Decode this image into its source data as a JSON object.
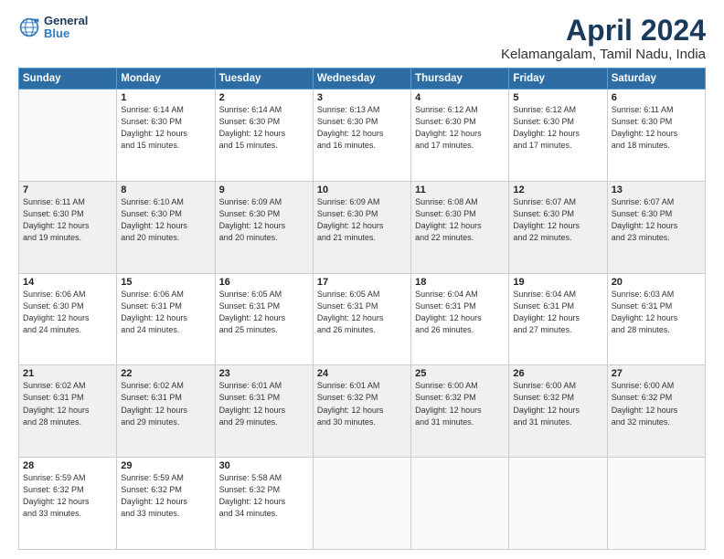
{
  "logo": {
    "line1": "General",
    "line2": "Blue"
  },
  "title": "April 2024",
  "subtitle": "Kelamangalam, Tamil Nadu, India",
  "days_of_week": [
    "Sunday",
    "Monday",
    "Tuesday",
    "Wednesday",
    "Thursday",
    "Friday",
    "Saturday"
  ],
  "weeks": [
    [
      {
        "date": "",
        "info": ""
      },
      {
        "date": "1",
        "info": "Sunrise: 6:14 AM\nSunset: 6:30 PM\nDaylight: 12 hours\nand 15 minutes."
      },
      {
        "date": "2",
        "info": "Sunrise: 6:14 AM\nSunset: 6:30 PM\nDaylight: 12 hours\nand 15 minutes."
      },
      {
        "date": "3",
        "info": "Sunrise: 6:13 AM\nSunset: 6:30 PM\nDaylight: 12 hours\nand 16 minutes."
      },
      {
        "date": "4",
        "info": "Sunrise: 6:12 AM\nSunset: 6:30 PM\nDaylight: 12 hours\nand 17 minutes."
      },
      {
        "date": "5",
        "info": "Sunrise: 6:12 AM\nSunset: 6:30 PM\nDaylight: 12 hours\nand 17 minutes."
      },
      {
        "date": "6",
        "info": "Sunrise: 6:11 AM\nSunset: 6:30 PM\nDaylight: 12 hours\nand 18 minutes."
      }
    ],
    [
      {
        "date": "7",
        "info": "Sunrise: 6:11 AM\nSunset: 6:30 PM\nDaylight: 12 hours\nand 19 minutes."
      },
      {
        "date": "8",
        "info": "Sunrise: 6:10 AM\nSunset: 6:30 PM\nDaylight: 12 hours\nand 20 minutes."
      },
      {
        "date": "9",
        "info": "Sunrise: 6:09 AM\nSunset: 6:30 PM\nDaylight: 12 hours\nand 20 minutes."
      },
      {
        "date": "10",
        "info": "Sunrise: 6:09 AM\nSunset: 6:30 PM\nDaylight: 12 hours\nand 21 minutes."
      },
      {
        "date": "11",
        "info": "Sunrise: 6:08 AM\nSunset: 6:30 PM\nDaylight: 12 hours\nand 22 minutes."
      },
      {
        "date": "12",
        "info": "Sunrise: 6:07 AM\nSunset: 6:30 PM\nDaylight: 12 hours\nand 22 minutes."
      },
      {
        "date": "13",
        "info": "Sunrise: 6:07 AM\nSunset: 6:30 PM\nDaylight: 12 hours\nand 23 minutes."
      }
    ],
    [
      {
        "date": "14",
        "info": "Sunrise: 6:06 AM\nSunset: 6:30 PM\nDaylight: 12 hours\nand 24 minutes."
      },
      {
        "date": "15",
        "info": "Sunrise: 6:06 AM\nSunset: 6:31 PM\nDaylight: 12 hours\nand 24 minutes."
      },
      {
        "date": "16",
        "info": "Sunrise: 6:05 AM\nSunset: 6:31 PM\nDaylight: 12 hours\nand 25 minutes."
      },
      {
        "date": "17",
        "info": "Sunrise: 6:05 AM\nSunset: 6:31 PM\nDaylight: 12 hours\nand 26 minutes."
      },
      {
        "date": "18",
        "info": "Sunrise: 6:04 AM\nSunset: 6:31 PM\nDaylight: 12 hours\nand 26 minutes."
      },
      {
        "date": "19",
        "info": "Sunrise: 6:04 AM\nSunset: 6:31 PM\nDaylight: 12 hours\nand 27 minutes."
      },
      {
        "date": "20",
        "info": "Sunrise: 6:03 AM\nSunset: 6:31 PM\nDaylight: 12 hours\nand 28 minutes."
      }
    ],
    [
      {
        "date": "21",
        "info": "Sunrise: 6:02 AM\nSunset: 6:31 PM\nDaylight: 12 hours\nand 28 minutes."
      },
      {
        "date": "22",
        "info": "Sunrise: 6:02 AM\nSunset: 6:31 PM\nDaylight: 12 hours\nand 29 minutes."
      },
      {
        "date": "23",
        "info": "Sunrise: 6:01 AM\nSunset: 6:31 PM\nDaylight: 12 hours\nand 29 minutes."
      },
      {
        "date": "24",
        "info": "Sunrise: 6:01 AM\nSunset: 6:32 PM\nDaylight: 12 hours\nand 30 minutes."
      },
      {
        "date": "25",
        "info": "Sunrise: 6:00 AM\nSunset: 6:32 PM\nDaylight: 12 hours\nand 31 minutes."
      },
      {
        "date": "26",
        "info": "Sunrise: 6:00 AM\nSunset: 6:32 PM\nDaylight: 12 hours\nand 31 minutes."
      },
      {
        "date": "27",
        "info": "Sunrise: 6:00 AM\nSunset: 6:32 PM\nDaylight: 12 hours\nand 32 minutes."
      }
    ],
    [
      {
        "date": "28",
        "info": "Sunrise: 5:59 AM\nSunset: 6:32 PM\nDaylight: 12 hours\nand 33 minutes."
      },
      {
        "date": "29",
        "info": "Sunrise: 5:59 AM\nSunset: 6:32 PM\nDaylight: 12 hours\nand 33 minutes."
      },
      {
        "date": "30",
        "info": "Sunrise: 5:58 AM\nSunset: 6:32 PM\nDaylight: 12 hours\nand 34 minutes."
      },
      {
        "date": "",
        "info": ""
      },
      {
        "date": "",
        "info": ""
      },
      {
        "date": "",
        "info": ""
      },
      {
        "date": "",
        "info": ""
      }
    ]
  ]
}
